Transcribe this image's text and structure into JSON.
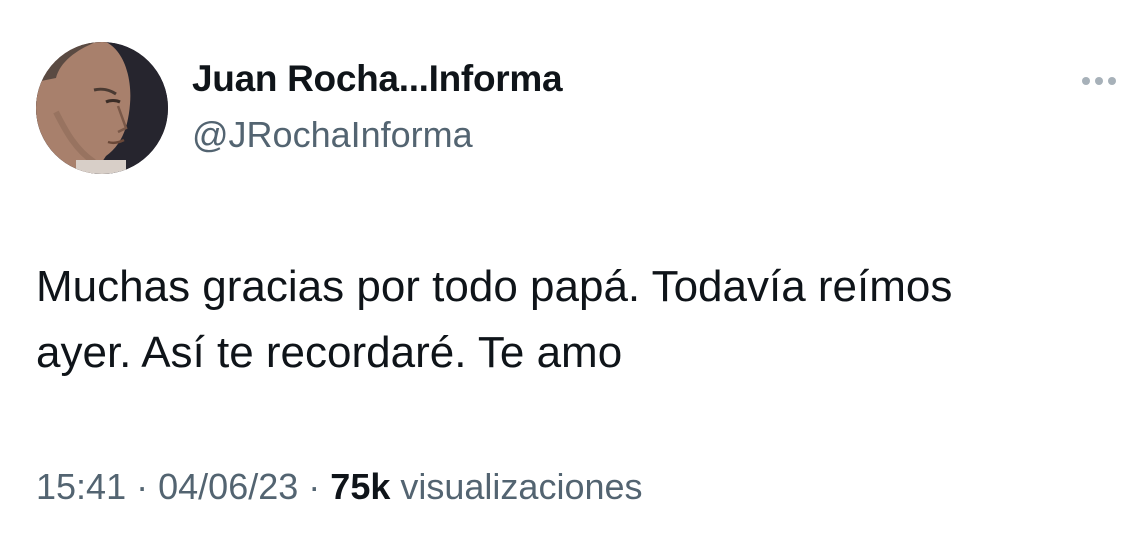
{
  "tweet": {
    "author": {
      "display_name": "Juan Rocha...Informa",
      "handle": "@JRochaInforma",
      "avatar": "user-avatar-photo"
    },
    "text_line1": "Muchas gracias por todo papá. Todavía reímos",
    "text_line2": "ayer. Así te recordaré. Te amo",
    "time": "15:41",
    "separator": "·",
    "date": "04/06/23",
    "views_count": "75k",
    "views_label": "visualizaciones"
  },
  "icons": {
    "more": "more-dots-icon"
  },
  "colors": {
    "text": "#0f1419",
    "secondary": "#536471",
    "dots": "#a7b1b9"
  }
}
